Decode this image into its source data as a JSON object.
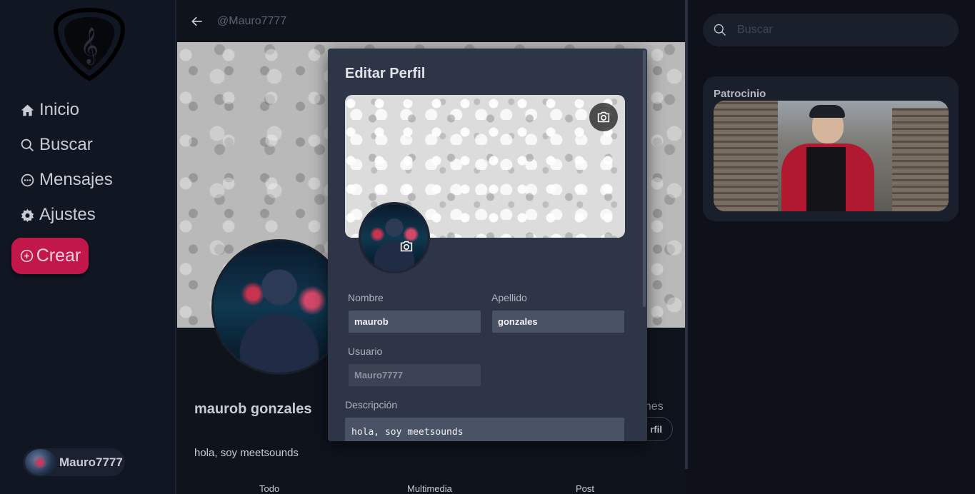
{
  "sidebar": {
    "nav": [
      {
        "label": "Inicio",
        "icon": "home-icon"
      },
      {
        "label": "Buscar",
        "icon": "search-icon"
      },
      {
        "label": "Mensajes",
        "icon": "messages-icon"
      },
      {
        "label": "Ajustes",
        "icon": "settings-icon"
      }
    ],
    "create_label": "Crear",
    "user_chip": "Mauro7777"
  },
  "topbar": {
    "handle": "@Mauro7777"
  },
  "profile": {
    "name": "maurob gonzales",
    "bio": "hola, soy meetsounds",
    "follow_text": "ones",
    "edit_button": "rfil",
    "tabs": [
      "Todo",
      "Multimedia",
      "Post"
    ]
  },
  "right": {
    "search_placeholder": "Buscar",
    "sponsor_title": "Patrocinio"
  },
  "modal": {
    "title": "Editar Perfil",
    "nombre_label": "Nombre",
    "nombre_value": "maurob",
    "apellido_label": "Apellido",
    "apellido_value": "gonzales",
    "usuario_label": "Usuario",
    "usuario_value": "Mauro7777",
    "descripcion_label": "Descripción",
    "descripcion_value": "hola, soy meetsounds"
  },
  "colors": {
    "accent": "#c2174a",
    "modal_bg": "#2e3546",
    "input_bg": "#4a5366"
  }
}
